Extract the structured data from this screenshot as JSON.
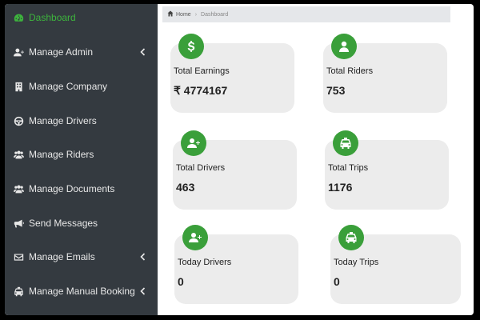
{
  "sidebar": {
    "items": [
      {
        "label": "Dashboard",
        "icon": "dashboard-icon",
        "active": true
      },
      {
        "label": "Manage Admin",
        "icon": "user-plus-icon",
        "chevron": true
      },
      {
        "label": "Manage Company",
        "icon": "building-icon"
      },
      {
        "label": "Manage Drivers",
        "icon": "steering-wheel-icon"
      },
      {
        "label": "Manage Riders",
        "icon": "users-icon"
      },
      {
        "label": "Manage Documents",
        "icon": "users-icon"
      },
      {
        "label": "Send Messages",
        "icon": "megaphone-icon"
      },
      {
        "label": "Manage Emails",
        "icon": "envelope-icon",
        "chevron": true
      },
      {
        "label": "Manage Manual Booking",
        "icon": "taxi-icon",
        "chevron": true
      }
    ]
  },
  "breadcrumb": {
    "home": "Home",
    "current": "Dashboard"
  },
  "cards": [
    {
      "label": "Total Earnings",
      "value": "₹ 4774167",
      "icon": "dollar-icon"
    },
    {
      "label": "Total Riders",
      "value": "753",
      "icon": "user-icon"
    },
    {
      "label": "Total Drivers",
      "value": "463",
      "icon": "user-plus-icon"
    },
    {
      "label": "Total Trips",
      "value": "1176",
      "icon": "taxi-icon"
    },
    {
      "label": "Today Drivers",
      "value": "0",
      "icon": "user-plus-icon"
    },
    {
      "label": "Today Trips",
      "value": "0",
      "icon": "taxi-icon"
    }
  ],
  "colors": {
    "sidebar_bg": "#343a40",
    "accent_green": "#3a9f3a",
    "card_bg": "#ececec"
  }
}
